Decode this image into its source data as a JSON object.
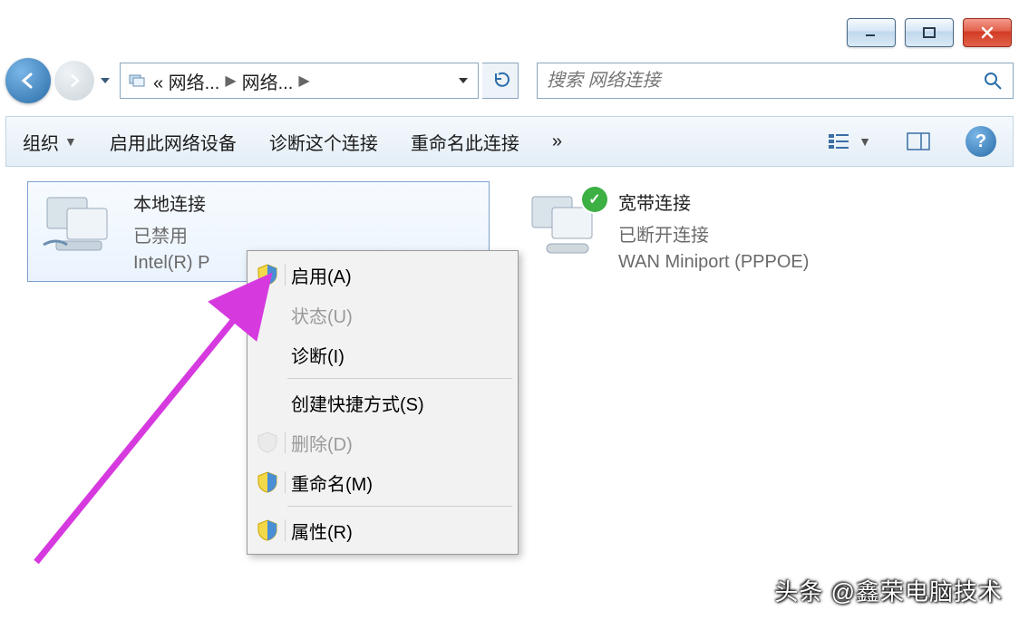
{
  "breadcrumb": {
    "root_icon": "network-location-icon",
    "part1": "« 网络...",
    "part2": "网络...",
    "search_placeholder": "搜索 网络连接"
  },
  "toolbar": {
    "organize": "组织",
    "enable_device": "启用此网络设备",
    "diagnose": "诊断这个连接",
    "rename": "重命名此连接",
    "overflow": "»"
  },
  "connections": {
    "local": {
      "title": "本地连接",
      "status": "已禁用",
      "device": "Intel(R) P"
    },
    "wan": {
      "title": "宽带连接",
      "status": "已断开连接",
      "device": "WAN Miniport (PPPOE)"
    }
  },
  "context_menu": {
    "enable": "启用(A)",
    "status": "状态(U)",
    "diagnose": "诊断(I)",
    "create_shortcut": "创建快捷方式(S)",
    "delete": "删除(D)",
    "rename": "重命名(M)",
    "properties": "属性(R)"
  },
  "watermark": "头条 @鑫荣电脑技术"
}
